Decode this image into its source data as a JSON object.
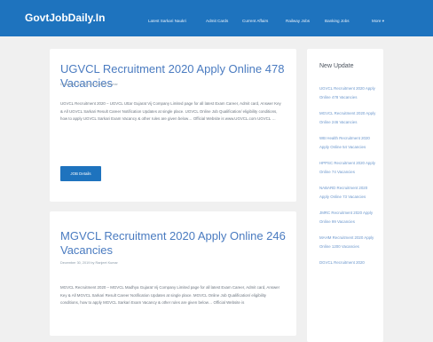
{
  "header": {
    "brand": "GovtJobDaily.In",
    "nav": [
      "Latest Sarkari Naukri",
      "Admit Cards",
      "Current Affairs",
      "Railway Jobs",
      "Banking Jobs",
      "More ▾"
    ]
  },
  "posts": [
    {
      "title": "UGVCL Recruitment 2020 Apply Online 478 Vacancies",
      "meta": "December 30, 2019 by Ranjeet Kumar",
      "excerpt": "UGVCL Recruitment 2020 – UGVCL Uttar Gujarat Vij Company Limited page for all latest Exam Career, Admit card, Answer Key & All UGVCL Sarkari Result Career Notification Updates at single place. UGVCL Online Job Qualification/ eligibility conditions, how to apply UGVCL Sarkari Exam Vacancy & other rules are given below… Official Website is www.UGVCL.com UGVCL …",
      "button": "JOB Details"
    },
    {
      "title": "MGVCL Recruitment 2020 Apply Online 246 Vacancies",
      "meta": "December 30, 2019 by Ranjeet Kumar",
      "excerpt": "MGVCL Recruitment 2020 – MGVCL Madhya Gujarat Vij Company Limited page for all latest Exam Career, Admit card, Answer Key & All MGVCL Sarkari Result Career Notification Updates at single place. MGVCL Online Job Qualification/ eligibility conditions, how to apply MGVCL Sarkari Exam Vacancy & other rules are given below… Official Website is"
    }
  ],
  "sidebar": {
    "title": "New Update",
    "links": [
      "UGVCL Recruitment 2020 Apply Online 478 Vacancies",
      "MGVCL Recruitment 2020 Apply Online 246 Vacancies",
      "WB Health Recruitment 2020 Apply Online 54 Vacancies",
      "HPPSC Recruitment 2020 Apply Online 74 Vacancies",
      "NABARD Recruitment 2020 Apply Online 73 Vacancies",
      "JMRC Recruitment 2020 Apply Online 99 Vacancies",
      "MAHM Recruitment 2020 Apply Online 1200 Vacancies",
      "DGVCL Recruitment 2020"
    ]
  }
}
